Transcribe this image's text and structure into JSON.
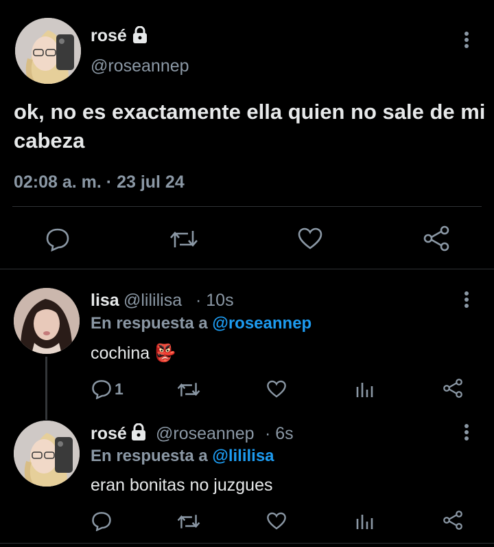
{
  "main_tweet": {
    "name": "rosé",
    "handle": "@roseannep",
    "text": "ok, no es exactamente ella quien no sale de mi cabeza",
    "timestamp": "02:08 a. m. · 23 jul 24"
  },
  "reply1": {
    "name": "lisa",
    "handle": "@lililisa",
    "time": "· 10s",
    "reply_prefix": "En respuesta a",
    "reply_target": "@roseannep",
    "text": "cochina",
    "emoji": "👺",
    "reply_count": "1"
  },
  "reply2": {
    "name": "rosé",
    "handle": "@roseannep",
    "time": "· 6s",
    "reply_prefix": "En respuesta a",
    "reply_target": "@lililisa",
    "text": "eran bonitas no juzgues"
  },
  "colors": {
    "background": "#000000",
    "text": "#e7e9ea",
    "muted": "#8b98a5",
    "link": "#1d9bf0",
    "divider": "#2f3336"
  },
  "icons": [
    "lock-icon",
    "more-icon",
    "reply-icon",
    "retweet-icon",
    "like-icon",
    "share-icon",
    "analytics-icon"
  ]
}
